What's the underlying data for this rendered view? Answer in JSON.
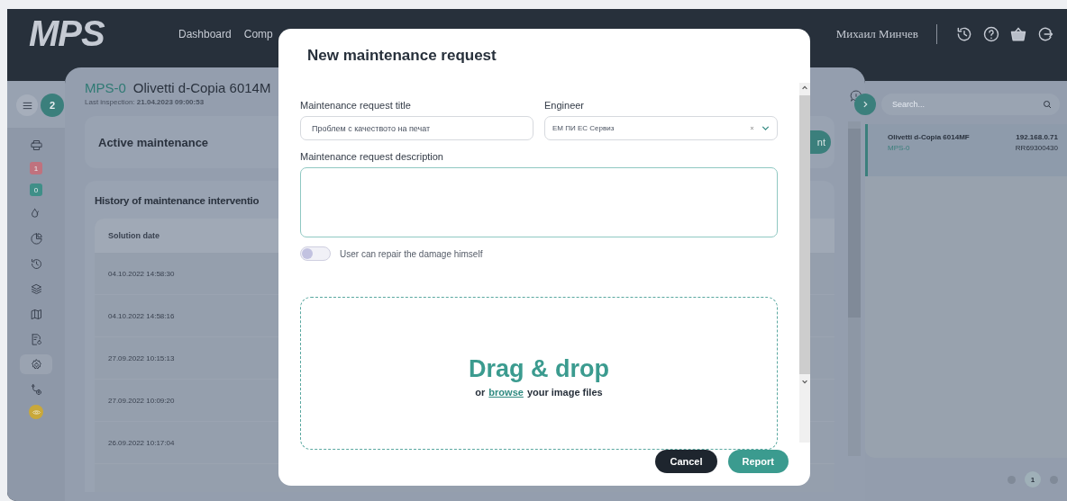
{
  "header": {
    "logo": "MPS",
    "nav": [
      {
        "label": "Dashboard"
      },
      {
        "label": "Comp"
      }
    ],
    "user": "Михаил Минчев"
  },
  "sidebar": {
    "filter_count": "2",
    "items": [
      {
        "kind": "icon",
        "selected": false
      },
      {
        "kind": "badge",
        "text": "1",
        "color": "#c0727e"
      },
      {
        "kind": "badge",
        "text": "0",
        "color": "#3f8f88"
      },
      {
        "kind": "icon",
        "selected": false
      },
      {
        "kind": "icon",
        "selected": false
      },
      {
        "kind": "icon",
        "selected": false
      },
      {
        "kind": "icon",
        "selected": false
      },
      {
        "kind": "icon",
        "selected": false
      },
      {
        "kind": "icon",
        "selected": false
      },
      {
        "kind": "icon",
        "selected": true
      },
      {
        "kind": "icon",
        "selected": false
      },
      {
        "kind": "dot",
        "color": "#c9a83a"
      }
    ]
  },
  "device": {
    "code": "MPS-0",
    "name": "Olivetti d-Copia 6014M",
    "last_inspection": "Last inspection: **21.04.2023 09:00:53**"
  },
  "active_maintenance": {
    "title": "Active maintenance",
    "button": "nt"
  },
  "history": {
    "title": "History of maintenance interventio",
    "columns": [
      "Solution date"
    ],
    "rows": [
      [
        "04.10.2022 14:58:30"
      ],
      [
        "04.10.2022 14:58:16"
      ],
      [
        "27.09.2022 10:15:13"
      ],
      [
        "27.09.2022 10:09:20"
      ],
      [
        "26.09.2022 10:17:04"
      ]
    ]
  },
  "right_panel": {
    "search": {
      "placeholder": "Search..."
    },
    "devices": [
      {
        "name": "Olivetti d-Copia 6014MF",
        "ip": "192.168.0.71",
        "code": "MPS-0",
        "serial": "RR69300430",
        "selected": true
      }
    ],
    "pages": [
      {
        "label": "1",
        "selected": true
      }
    ]
  },
  "modal": {
    "title": "New maintenance request",
    "title_field": {
      "label": "Maintenance request title",
      "value": "Проблем с качеството на печат"
    },
    "engineer_field": {
      "label": "Engineer",
      "value": "ЕМ ПИ ЕС Сервиз"
    },
    "description_field": {
      "label": "Maintenance request description"
    },
    "self_repair": {
      "label": "User can repair the damage himself",
      "on": false
    },
    "dropzone": {
      "title": "Drag & drop",
      "hint_before": "or",
      "link": "browse",
      "hint_after": "your image files"
    },
    "buttons": [
      {
        "label": "Cancel",
        "kind": "secondary"
      },
      {
        "label": "Report",
        "kind": "primary"
      }
    ]
  }
}
